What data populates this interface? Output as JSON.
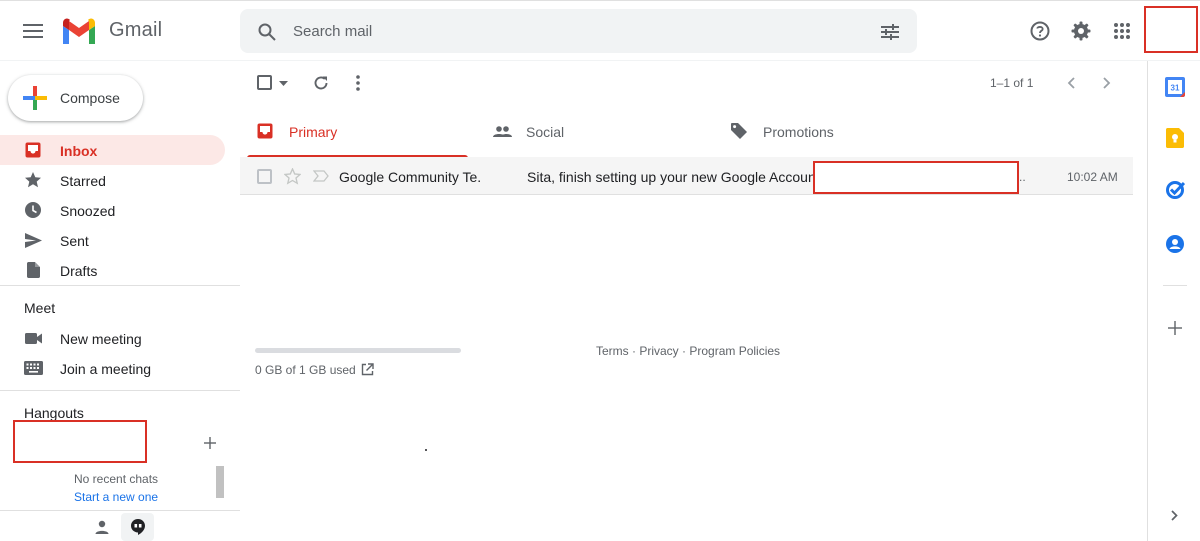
{
  "header": {
    "app_name": "Gmail",
    "search_placeholder": "Search mail"
  },
  "sidebar": {
    "compose_label": "Compose",
    "items": [
      {
        "label": "Inbox",
        "icon": "inbox-icon",
        "active": true
      },
      {
        "label": "Starred",
        "icon": "star-icon"
      },
      {
        "label": "Snoozed",
        "icon": "clock-icon"
      },
      {
        "label": "Sent",
        "icon": "send-icon"
      },
      {
        "label": "Drafts",
        "icon": "draft-icon"
      }
    ],
    "meet": {
      "title": "Meet",
      "new_meeting": "New meeting",
      "join_meeting": "Join a meeting"
    },
    "hangouts": {
      "title": "Hangouts",
      "no_recent": "No recent chats",
      "start_new": "Start a new one"
    }
  },
  "toolbar": {
    "pagination": "1–1 of 1"
  },
  "tabs": [
    {
      "label": "Primary",
      "active": true
    },
    {
      "label": "Social"
    },
    {
      "label": "Promotions"
    }
  ],
  "mail": {
    "sender": "Google Community Te.",
    "subject": "Sita, finish setting up your new Google Account",
    "snippet_tail": "..",
    "time": "10:02 AM"
  },
  "footer": {
    "storage": "0 GB of 1 GB used",
    "terms": "Terms",
    "sep1": " · ",
    "privacy": "Privacy",
    "sep2": " · ",
    "policies": "Program Policies"
  },
  "colors": {
    "accent_red": "#d93025",
    "active_bg": "#fce8e6",
    "link_blue": "#1a73e8"
  }
}
